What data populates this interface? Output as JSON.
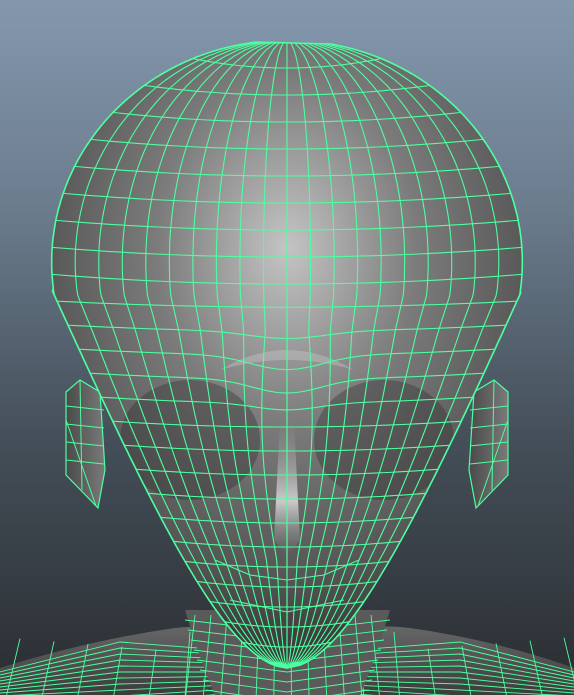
{
  "viewport": {
    "name": "3d-viewport",
    "background_top": "#8497ad",
    "background_bottom": "#2a2d31"
  },
  "model": {
    "name": "head-mesh",
    "shading": "smooth-shaded-with-wireframe",
    "surface_color": "#6e6e6e",
    "highlight_color": "#c6c6c6",
    "wireframe_color": "#4dffa0",
    "parts": [
      "skull",
      "face",
      "left-ear",
      "right-ear",
      "neck",
      "shoulders"
    ]
  }
}
